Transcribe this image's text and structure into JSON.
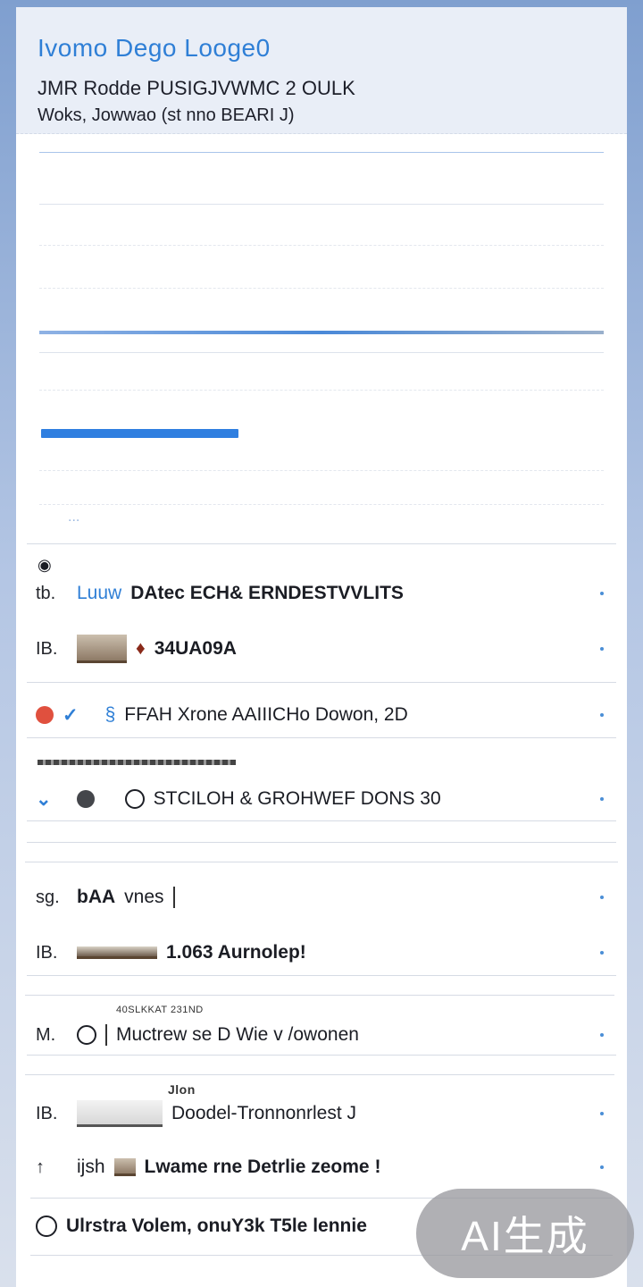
{
  "header": {
    "title": "Ivomo Dego Looge0",
    "subtitle1": "JMR Rodde PUSIGJVWMC 2 OULK",
    "subtitle2": "Woks, Jowwao (st nno BEARI J)"
  },
  "skeleton": {
    "progress_fraction": 0.35,
    "label": "..."
  },
  "list": [
    {
      "lead": "tb.",
      "link": "Luuw",
      "text": "DAtec ECH& ERNDESTVVLITS"
    },
    {
      "lead": "IB.",
      "text": "34UA09A"
    },
    {
      "text": "FFAH Xrone AAIIICHo Dowon, 2D"
    },
    {
      "text": "STCILOH & GROHWEF DONS 30"
    },
    {
      "lead": "sg.",
      "text": "bAA",
      "suffix": "vnes"
    },
    {
      "lead": "IB.",
      "text": "1.063 Aurnolep!"
    },
    {
      "lead": "M.",
      "hint": "40SLKKAT 231ND",
      "text": "Muctrew se D Wie v /owonen"
    },
    {
      "lead": "IB.",
      "tag": "Jlon",
      "text": "Doodel-Tronnonrlest J"
    },
    {
      "lead": "↑",
      "text": "Lwame rne Detrlie zeome !",
      "prefix": "ijsh"
    },
    {
      "text": "Ulrstra Volem, onuY3k T5le lennie"
    }
  ],
  "watermark": "AI生成"
}
